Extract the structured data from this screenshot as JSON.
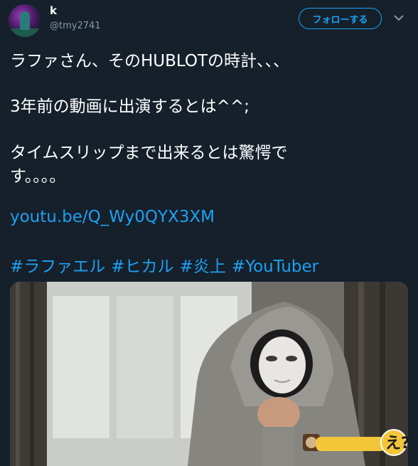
{
  "user": {
    "display_name": "k",
    "handle": "@tmy2741",
    "avatar_icon": "avatar-image"
  },
  "header": {
    "follow_label": "フォローする",
    "more_icon": "chevron-down-icon"
  },
  "tweet": {
    "line1": "ラファさん、そのHUBLOTの時計、、、",
    "line2": "3年前の動画に出演するとは^^;",
    "line3": "タイムスリップまで出来るとは驚愕で",
    "line4": "す。。。。",
    "link": "youtu.be/Q_Wy0QYX3XM",
    "hashtags": [
      "#ラファエル",
      "#ヒカル",
      "#炎上",
      "#YouTuber"
    ]
  },
  "media": {
    "caption_sticker": "え?"
  },
  "colors": {
    "background": "#15202b",
    "accent": "#1da1f2",
    "secondary_text": "#8899a6"
  }
}
